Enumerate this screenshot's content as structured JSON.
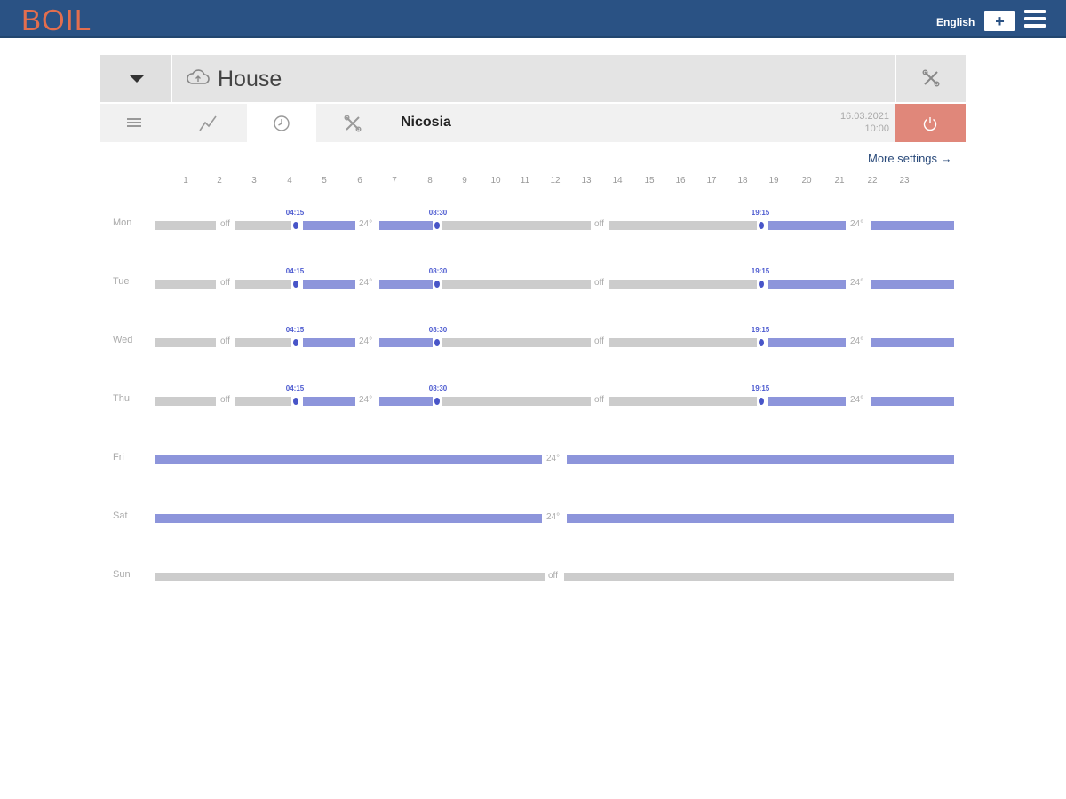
{
  "header": {
    "logo": "BOIL",
    "language": "English",
    "add_label": "+"
  },
  "device": {
    "name": "House",
    "city": "Nicosia",
    "date": "16.03.2021",
    "time": "10:00"
  },
  "more_settings": "More settings →",
  "hours": [
    "1",
    "2",
    "3",
    "4",
    "5",
    "6",
    "7",
    "8",
    "9",
    "10",
    "11",
    "12",
    "13",
    "14",
    "15",
    "16",
    "17",
    "18",
    "19",
    "20",
    "21",
    "22",
    "23"
  ],
  "days": [
    {
      "name": "Mon",
      "times": [
        "04:15",
        "08:30",
        "19:15"
      ],
      "labels": [
        "off",
        "24°",
        "off",
        "24°"
      ]
    },
    {
      "name": "Tue",
      "times": [
        "04:15",
        "08:30",
        "19:15"
      ],
      "labels": [
        "off",
        "24°",
        "off",
        "24°"
      ]
    },
    {
      "name": "Wed",
      "times": [
        "04:15",
        "08:30",
        "19:15"
      ],
      "labels": [
        "off",
        "24°",
        "off",
        "24°"
      ]
    },
    {
      "name": "Thu",
      "times": [
        "04:15",
        "08:30",
        "19:15"
      ],
      "labels": [
        "off",
        "24°",
        "off",
        "24°"
      ]
    },
    {
      "name": "Fri",
      "labels": [
        "24°"
      ]
    },
    {
      "name": "Sat",
      "labels": [
        "24°"
      ]
    },
    {
      "name": "Sun",
      "labels": [
        "off"
      ]
    }
  ],
  "colors": {
    "topbar": "#2a5284",
    "logo": "#e36e4e",
    "power": "#e0877a",
    "heat_segment": "#8d95db",
    "off_segment": "#cccccc"
  },
  "icons": [
    "cloud-icon",
    "dropdown-arrow-icon",
    "tools-icon",
    "list-icon",
    "chart-line-icon",
    "clock-icon",
    "power-icon",
    "hamburger-menu-icon"
  ]
}
